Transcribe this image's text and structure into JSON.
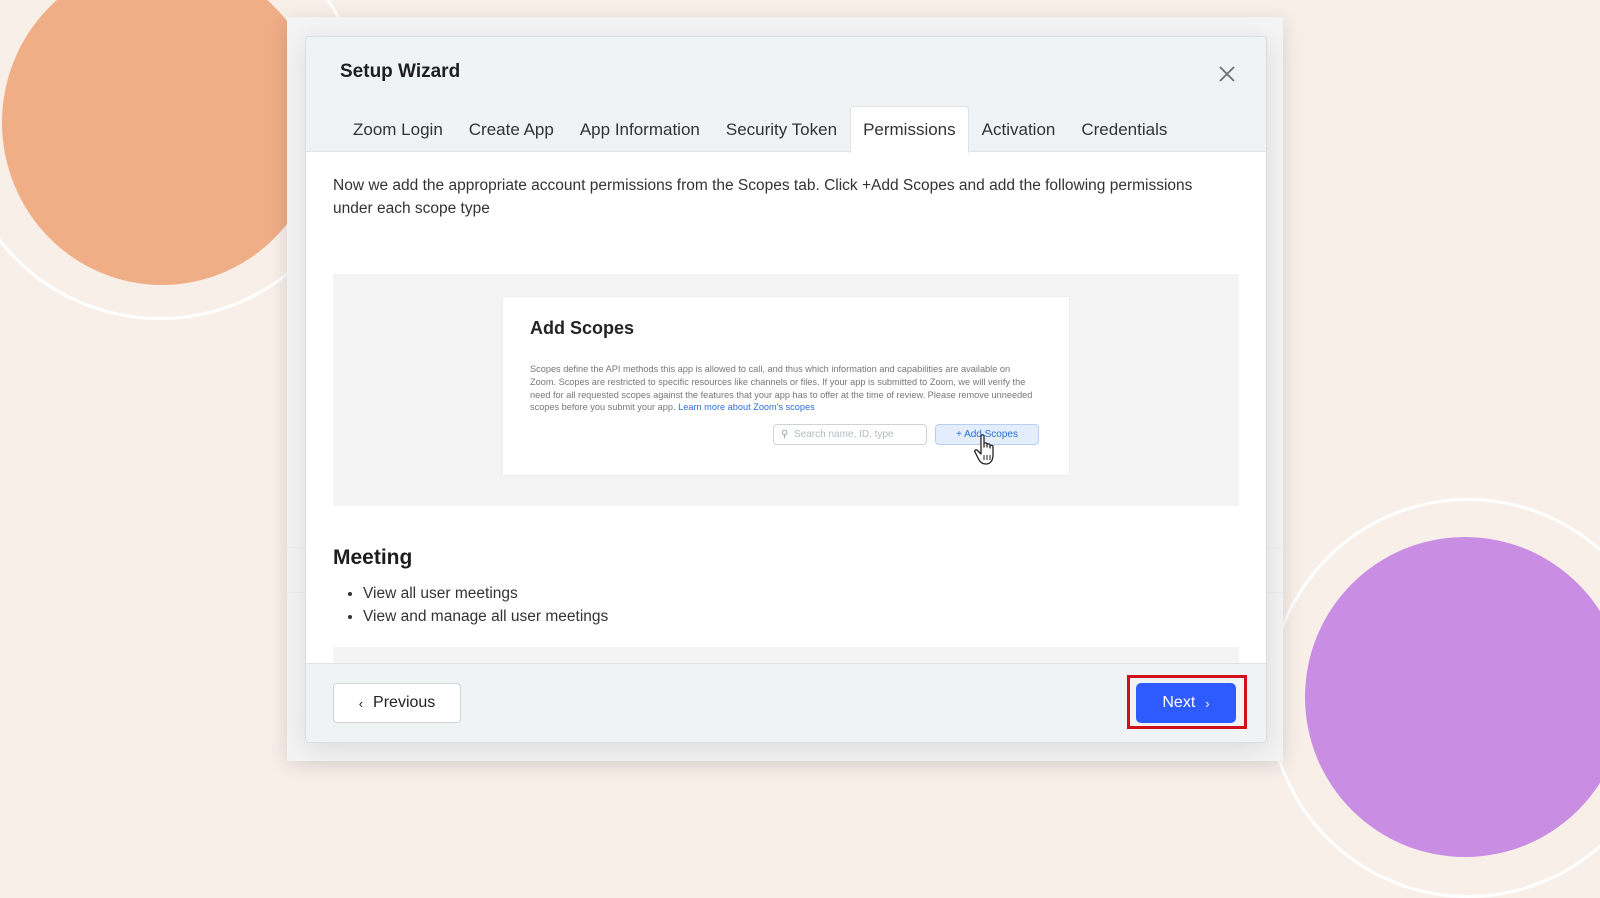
{
  "modal": {
    "title": "Setup Wizard",
    "close_icon": "close-icon"
  },
  "tabs": [
    {
      "label": "Zoom Login",
      "active": false
    },
    {
      "label": "Create App",
      "active": false
    },
    {
      "label": "App Information",
      "active": false
    },
    {
      "label": "Security Token",
      "active": false
    },
    {
      "label": "Permissions",
      "active": true
    },
    {
      "label": "Activation",
      "active": false
    },
    {
      "label": "Credentials",
      "active": false
    }
  ],
  "body": {
    "intro": "Now we add the appropriate account permissions from the Scopes tab. Click +Add Scopes and add the following permissions under each scope type",
    "screenshot": {
      "title": "Add Scopes",
      "description": "Scopes define the API methods this app is allowed to call, and thus which information and capabilities are available on Zoom. Scopes are restricted to specific resources like channels or files. If your app is submitted to Zoom, we will verify the need for all requested scopes against the features that your app has to offer at the time of review. Please remove unneeded scopes before you submit your app.",
      "link_text": "Learn more about Zoom's scopes",
      "search_placeholder": "Search name, ID, type",
      "add_button": "+ Add Scopes"
    },
    "section_heading": "Meeting",
    "permissions": [
      "View all user meetings",
      "View and manage all user meetings"
    ]
  },
  "footer": {
    "previous_label": "Previous",
    "next_label": "Next"
  },
  "colors": {
    "primary": "#2d5bff",
    "highlight": "#d2101d",
    "background": "#f8efe9"
  }
}
